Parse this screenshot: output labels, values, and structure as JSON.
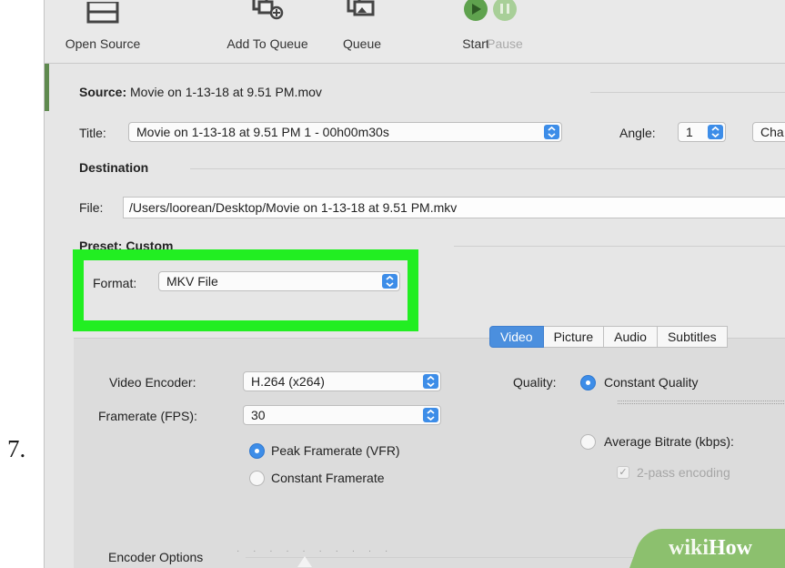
{
  "step_number": "7.",
  "toolbar": {
    "open_source": "Open Source",
    "add_to_queue": "Add To Queue",
    "queue": "Queue",
    "start": "Start",
    "pause": "Pause"
  },
  "source": {
    "label": "Source:",
    "value": "Movie on 1-13-18 at 9.51 PM.mov"
  },
  "title": {
    "label": "Title:",
    "value": "Movie on 1-13-18 at 9.51 PM 1 - 00h00m30s"
  },
  "angle": {
    "label": "Angle:",
    "value": "1"
  },
  "chapters_button_partial": "Cha",
  "destination": {
    "heading": "Destination",
    "file_label": "File:",
    "file_value": "/Users/loorean/Desktop/Movie on 1-13-18 at 9.51 PM.mkv"
  },
  "preset": {
    "label": "Preset:",
    "value": "Custom"
  },
  "format": {
    "label": "Format:",
    "value": "MKV File"
  },
  "tabs": [
    {
      "label": "Video",
      "active": true
    },
    {
      "label": "Picture",
      "active": false
    },
    {
      "label": "Audio",
      "active": false
    },
    {
      "label": "Subtitles",
      "active": false
    }
  ],
  "video": {
    "encoder_label": "Video Encoder:",
    "encoder_value": "H.264 (x264)",
    "framerate_label": "Framerate (FPS):",
    "framerate_value": "30",
    "peak_framerate": "Peak Framerate (VFR)",
    "constant_framerate": "Constant Framerate",
    "quality_label": "Quality:",
    "constant_quality": "Constant Quality",
    "average_bitrate": "Average Bitrate (kbps):",
    "two_pass": "2-pass encoding",
    "encoder_options": "Encoder Options"
  },
  "watermark": {
    "wiki": "wiki",
    "how": "How"
  },
  "colors": {
    "highlight": "#22ee22",
    "accent": "#3d8de8",
    "window": "#e6e6e6",
    "watermark": "#8cc06e"
  }
}
